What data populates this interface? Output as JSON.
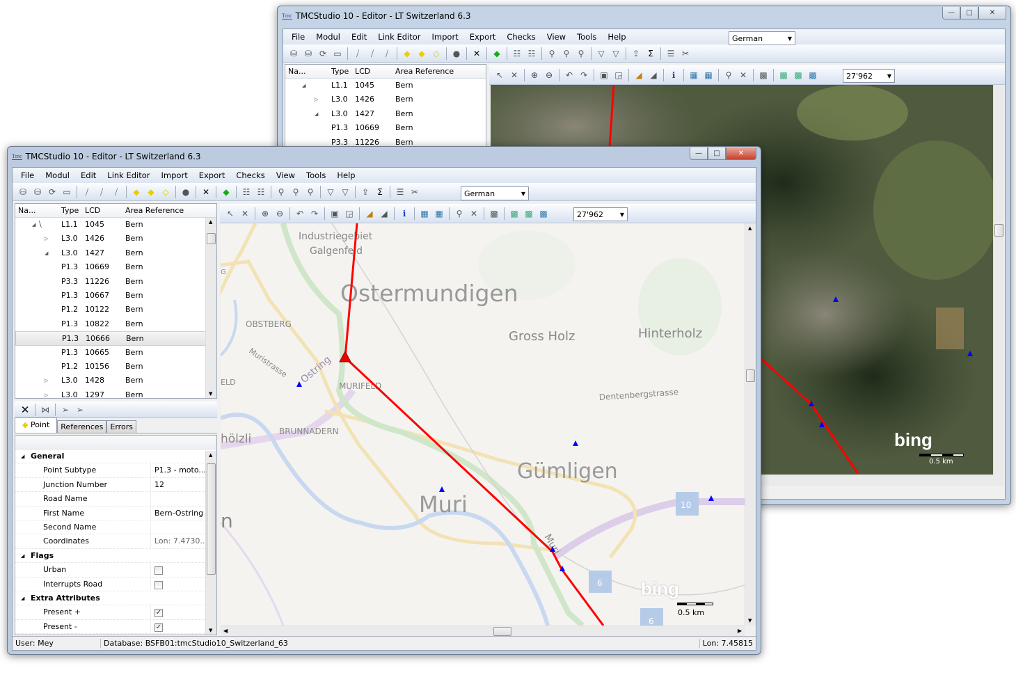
{
  "back_window": {
    "title": "TMCStudio 10 - Editor - LT Switzerland 6.3",
    "logo": "Tmc",
    "menu": [
      "File",
      "Modul",
      "Edit",
      "Link Editor",
      "Import",
      "Export",
      "Checks",
      "View",
      "Tools",
      "Help"
    ],
    "language": "German",
    "zoom": "27'962",
    "tree_headers": [
      "Na...",
      "Type",
      "LCD",
      "Area Reference"
    ],
    "tree_rows": [
      {
        "type": "L1.1",
        "lcd": "1045",
        "area": "Bern",
        "expander": "expanded"
      },
      {
        "type": "L3.0",
        "lcd": "1426",
        "area": "Bern",
        "expander": "collapsed"
      },
      {
        "type": "L3.0",
        "lcd": "1427",
        "area": "Bern",
        "expander": "expanded"
      },
      {
        "type": "P1.3",
        "lcd": "10669",
        "area": "Bern"
      },
      {
        "type": "P3.3",
        "lcd": "11226",
        "area": "Bern"
      }
    ],
    "map": {
      "provider": "bing",
      "scale": "0.5 km",
      "style": "aerial"
    }
  },
  "front_window": {
    "title": "TMCStudio 10 - Editor - LT Switzerland 6.3",
    "logo": "Tmc",
    "menu": [
      "File",
      "Modul",
      "Edit",
      "Link Editor",
      "Import",
      "Export",
      "Checks",
      "View",
      "Tools",
      "Help"
    ],
    "toolbar_icons": [
      "db-import-icon",
      "db-add-icon",
      "sync-icon",
      "window-icon",
      "sep",
      "link-icon",
      "link-add-icon",
      "link-disabled-icon",
      "sep",
      "point-add-icon",
      "point-move-icon",
      "point-erase-icon",
      "sep",
      "point-disabled-icon",
      "sep",
      "delete-icon",
      "sep",
      "green-diamond-icon",
      "sep",
      "tree-add-icon",
      "tree-remove-icon",
      "sep",
      "find-icon",
      "find-st-icon",
      "find-clear-icon",
      "sep",
      "filter-window-icon",
      "filter-icon",
      "sep",
      "export-icon",
      "sum-icon",
      "sep",
      "list-icon",
      "tools-icon"
    ],
    "language": "German",
    "map_toolbar_icons": [
      "select-icon",
      "deselect-icon",
      "sep",
      "zoom-in-icon",
      "zoom-out-icon",
      "sep",
      "zoom-prev-icon",
      "zoom-next-icon",
      "sep",
      "zoom-extent-icon",
      "zoom-select-icon",
      "sep",
      "chart-icon",
      "chart-edit-icon",
      "sep",
      "info-icon",
      "sep",
      "layer-icon",
      "layer-grid-icon",
      "sep",
      "find-map-icon",
      "clear-map-icon",
      "sep",
      "map-image-icon",
      "sep",
      "map-a-icon",
      "map-b-icon",
      "map-c-icon"
    ],
    "zoom": "27'962",
    "tree_headers": [
      "Na...",
      "Type",
      "LCD",
      "Area Reference"
    ],
    "tree_rows": [
      {
        "type": "L1.1",
        "lcd": "1045",
        "area": "Bern",
        "expander": "expanded",
        "icon": "road"
      },
      {
        "type": "L3.0",
        "lcd": "1426",
        "area": "Bern",
        "expander": "collapsed"
      },
      {
        "type": "L3.0",
        "lcd": "1427",
        "area": "Bern",
        "expander": "expanded"
      },
      {
        "type": "P1.3",
        "lcd": "10669",
        "area": "Bern"
      },
      {
        "type": "P3.3",
        "lcd": "11226",
        "area": "Bern"
      },
      {
        "type": "P1.3",
        "lcd": "10667",
        "area": "Bern"
      },
      {
        "type": "P1.2",
        "lcd": "10122",
        "area": "Bern"
      },
      {
        "type": "P1.3",
        "lcd": "10822",
        "area": "Bern"
      },
      {
        "type": "P1.3",
        "lcd": "10666",
        "area": "Bern",
        "selected": true
      },
      {
        "type": "P1.3",
        "lcd": "10665",
        "area": "Bern"
      },
      {
        "type": "P1.2",
        "lcd": "10156",
        "area": "Bern"
      },
      {
        "type": "L3.0",
        "lcd": "1428",
        "area": "Bern",
        "expander": "collapsed"
      },
      {
        "type": "L3.0",
        "lcd": "1297",
        "area": "Bern",
        "expander": "collapsed"
      }
    ],
    "tabs": [
      "Point",
      "References",
      "Errors"
    ],
    "properties": [
      {
        "category": "General"
      },
      {
        "label": "Point Subtype",
        "value": "P1.3 - moto..."
      },
      {
        "label": "Junction Number",
        "value": "12"
      },
      {
        "label": "Road Name",
        "value": ""
      },
      {
        "label": "First Name",
        "value": "Bern-Ostring"
      },
      {
        "label": "Second Name",
        "value": ""
      },
      {
        "label": "Coordinates",
        "value": "Lon: 7.4730...",
        "readonly": true
      },
      {
        "category": "Flags"
      },
      {
        "label": "Urban",
        "checked": false
      },
      {
        "label": "Interrupts Road",
        "checked": false
      },
      {
        "category": "Extra Attributes"
      },
      {
        "label": "Present +",
        "checked": true
      },
      {
        "label": "Present -",
        "checked": true
      }
    ],
    "map": {
      "provider": "bing",
      "scale": "0.5 km",
      "style": "road",
      "labels": {
        "industrie": "Industriegebiet",
        "galgenfeld": "Galgenfeld",
        "ostermundigen": "Ostermundigen",
        "obstberg": "OBSTBERG",
        "muristrasse": "Muristrasse",
        "ostring": "Ostring",
        "murifeld": "MURIFELD",
        "eld": "ELD",
        "gross_holz": "Gross Holz",
        "hinterholz": "Hinterholz",
        "dentenberg": "Dentenbergstrasse",
        "brunnadern": "BRUNNADERN",
        "holzli": "hölzli",
        "guemligen": "Gümligen",
        "muri": "Muri",
        "muri_small": "Muri",
        "n": "n",
        "g": "G",
        "r10": "10",
        "r6a": "6",
        "r6b": "6"
      },
      "line_color": "#ff0000",
      "point_color": "#0000ff"
    },
    "status": {
      "user": "User:  Mey",
      "database": "Database:  BSFB01:tmcStudio10_Switzerland_63",
      "lon": "Lon: 7.45815"
    }
  }
}
